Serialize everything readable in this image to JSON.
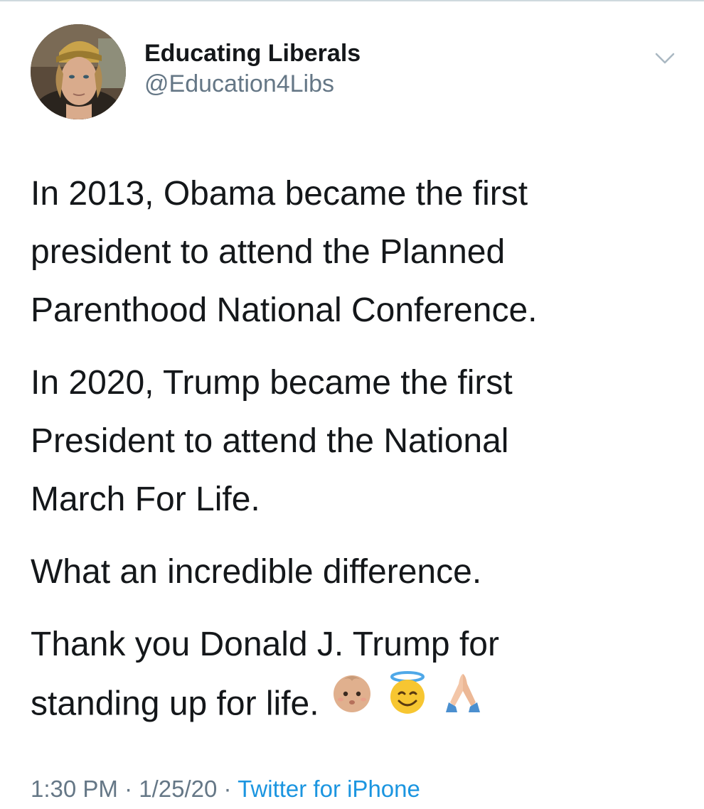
{
  "author": {
    "display_name": "Educating Liberals",
    "handle": "@Education4Libs"
  },
  "icons": {
    "caret": "chevron-down-icon",
    "caret_color": "#aab8c2"
  },
  "tweet": {
    "paragraphs": [
      {
        "lines": [
          "In 2013, Obama became the first",
          "president to attend the Planned",
          "Parenthood National Conference."
        ]
      },
      {
        "lines": [
          "In 2020, Trump became the first",
          "President to attend the National",
          "March For Life."
        ]
      },
      {
        "lines": [
          "What an incredible difference."
        ]
      },
      {
        "lines": [
          "Thank you Donald J. Trump for",
          "standing up for life."
        ]
      }
    ],
    "emojis": [
      "baby-emoji",
      "smiling-face-with-halo-emoji",
      "folded-hands-emoji"
    ]
  },
  "meta": {
    "time": "1:30 PM",
    "sep1": " · ",
    "date": "1/25/20",
    "sep2": " · ",
    "source": "Twitter for iPhone"
  },
  "colors": {
    "text": "#14171a",
    "secondary": "#657786",
    "link": "#1b95e0"
  }
}
